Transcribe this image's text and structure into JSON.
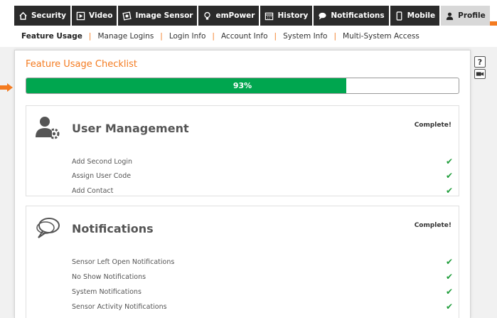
{
  "tabs": [
    {
      "label": "Security",
      "icon": "home-icon"
    },
    {
      "label": "Video",
      "icon": "play-icon"
    },
    {
      "label": "Image Sensor",
      "icon": "camera-icon"
    },
    {
      "label": "emPower",
      "icon": "lightbulb-icon"
    },
    {
      "label": "History",
      "icon": "calendar-icon"
    },
    {
      "label": "Notifications",
      "icon": "chat-icon"
    },
    {
      "label": "Mobile",
      "icon": "phone-icon"
    },
    {
      "label": "Profile",
      "icon": "user-icon",
      "active": true
    }
  ],
  "subnav": [
    {
      "label": "Feature Usage",
      "active": true
    },
    {
      "label": "Manage Logins"
    },
    {
      "label": "Login Info"
    },
    {
      "label": "Account Info"
    },
    {
      "label": "System Info"
    },
    {
      "label": "Multi-System Access"
    }
  ],
  "checklist": {
    "title": "Feature Usage Checklist",
    "progress_label": "93%",
    "progress_fraction": 0.74
  },
  "sections": [
    {
      "title": "User Management",
      "status": "Complete!",
      "icon": "user-gear-icon",
      "items": [
        "Add Second Login",
        "Assign User Code",
        "Add Contact"
      ]
    },
    {
      "title": "Notifications",
      "status": "Complete!",
      "icon": "speech-bubble-icon",
      "items": [
        "Sensor Left Open Notifications",
        "No Show Notifications",
        "System Notifications",
        "Sensor Activity Notifications"
      ]
    }
  ],
  "side_icons": {
    "help_label": "?"
  },
  "colors": {
    "accent": "#f47b20",
    "progress": "#00a64f",
    "check": "#1f9d3a",
    "tab_bg": "#2b2b2b"
  }
}
